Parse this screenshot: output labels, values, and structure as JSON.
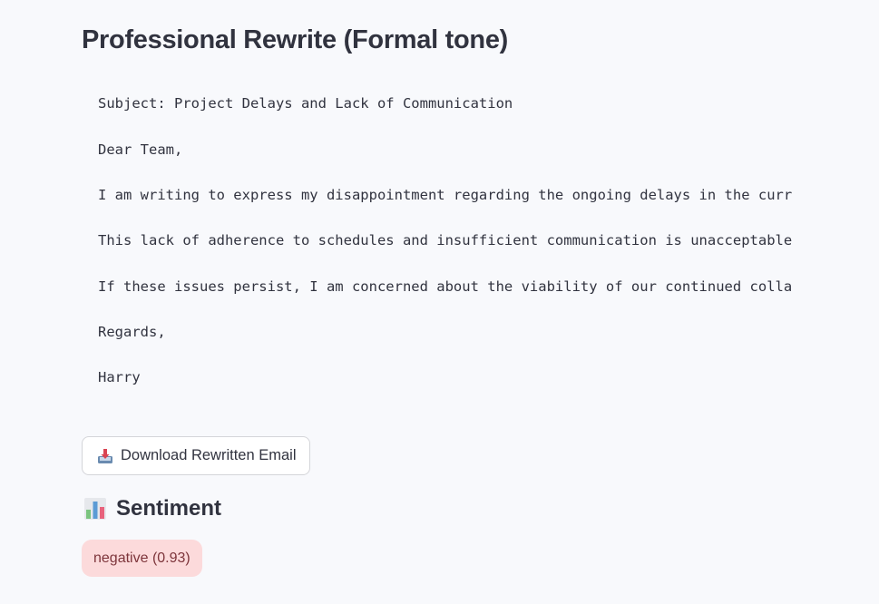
{
  "page": {
    "title": "Professional Rewrite (Formal tone)"
  },
  "email": {
    "lines": [
      "Subject: Project Delays and Lack of Communication",
      "Dear Team,",
      "I am writing to express my disappointment regarding the ongoing delays in the curr",
      "This lack of adherence to schedules and insufficient communication is unacceptable",
      "If these issues persist, I am concerned about the viability of our continued colla",
      "Regards,",
      "Harry"
    ]
  },
  "download": {
    "icon": "inbox-tray-icon",
    "label": "Download Rewritten Email"
  },
  "sentiment": {
    "icon": "bar-chart-icon",
    "heading": "Sentiment",
    "badge": "negative (0.93)",
    "badge_bg": "#fcdadb",
    "badge_color": "#7d353b"
  }
}
